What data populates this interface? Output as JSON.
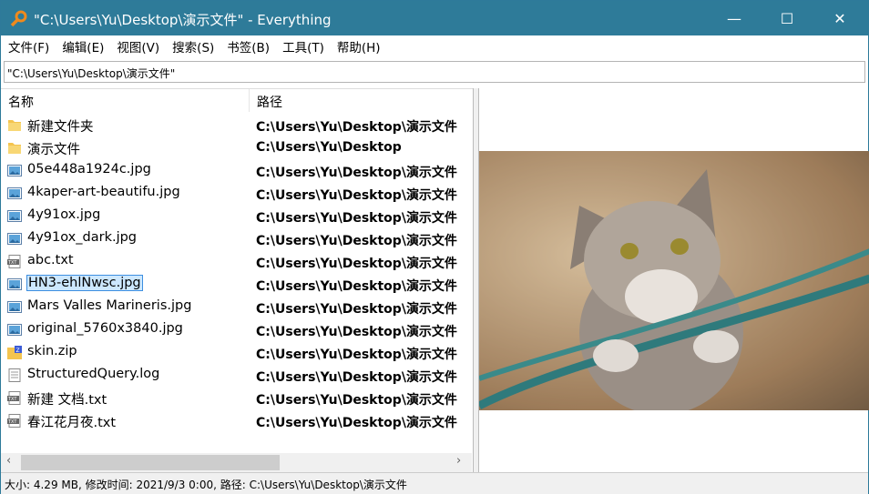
{
  "window": {
    "title": "\"C:\\Users\\Yu\\Desktop\\演示文件\" - Everything",
    "minimize": "—",
    "maximize": "☐",
    "close": "✕"
  },
  "menu": [
    "文件(F)",
    "编辑(E)",
    "视图(V)",
    "搜索(S)",
    "书签(B)",
    "工具(T)",
    "帮助(H)"
  ],
  "search": {
    "value": "\"C:\\Users\\Yu\\Desktop\\演示文件\""
  },
  "columns": {
    "name": "名称",
    "path": "路径"
  },
  "files": [
    {
      "name": "新建文件夹",
      "path": "C:\\Users\\Yu\\Desktop\\演示文件",
      "icon": "folder-icon"
    },
    {
      "name": "演示文件",
      "path": "C:\\Users\\Yu\\Desktop",
      "icon": "folder-icon"
    },
    {
      "name": "05e448a1924c.jpg",
      "path": "C:\\Users\\Yu\\Desktop\\演示文件",
      "icon": "image-icon"
    },
    {
      "name": "4kaper-art-beautifu.jpg",
      "path": "C:\\Users\\Yu\\Desktop\\演示文件",
      "icon": "image-icon"
    },
    {
      "name": "4y91ox.jpg",
      "path": "C:\\Users\\Yu\\Desktop\\演示文件",
      "icon": "image-icon"
    },
    {
      "name": "4y91ox_dark.jpg",
      "path": "C:\\Users\\Yu\\Desktop\\演示文件",
      "icon": "image-icon"
    },
    {
      "name": "abc.txt",
      "path": "C:\\Users\\Yu\\Desktop\\演示文件",
      "icon": "txt-icon"
    },
    {
      "name": "HN3-ehlNwsc.jpg",
      "path": "C:\\Users\\Yu\\Desktop\\演示文件",
      "icon": "image-icon",
      "selected": true
    },
    {
      "name": "Mars Valles Marineris.jpg",
      "path": "C:\\Users\\Yu\\Desktop\\演示文件",
      "icon": "image-icon"
    },
    {
      "name": "original_5760x3840.jpg",
      "path": "C:\\Users\\Yu\\Desktop\\演示文件",
      "icon": "image-icon"
    },
    {
      "name": "skin.zip",
      "path": "C:\\Users\\Yu\\Desktop\\演示文件",
      "icon": "zip-icon"
    },
    {
      "name": "StructuredQuery.log",
      "path": "C:\\Users\\Yu\\Desktop\\演示文件",
      "icon": "log-icon"
    },
    {
      "name": "新建 文档.txt",
      "path": "C:\\Users\\Yu\\Desktop\\演示文件",
      "icon": "txt-icon"
    },
    {
      "name": "春江花月夜.txt",
      "path": "C:\\Users\\Yu\\Desktop\\演示文件",
      "icon": "txt-icon"
    }
  ],
  "status": "大小: 4.29 MB, 修改时间: 2021/9/3 0:00, 路径: C:\\Users\\Yu\\Desktop\\演示文件",
  "colors": {
    "titlebar": "#2e7b99",
    "selection": "#cde8ff"
  }
}
